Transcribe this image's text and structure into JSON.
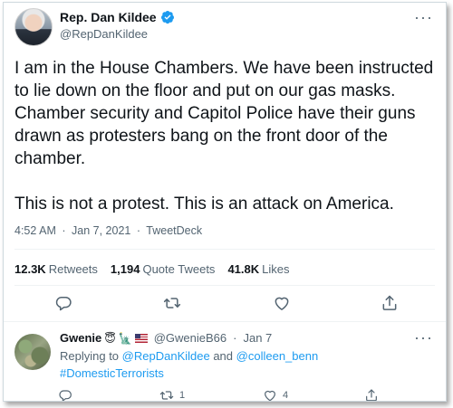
{
  "tweet": {
    "author_name": "Rep. Dan Kildee",
    "author_handle": "@RepDanKildee",
    "text": "I am in the House Chambers. We have been instructed\nto lie down on the floor and put on our gas masks.\nChamber security and Capitol Police have their guns\ndrawn as protesters bang on the front door of the\nchamber.\n\nThis is not a protest. This is an attack on America.",
    "time": "4:52 AM",
    "date": "Jan 7, 2021",
    "source": "TweetDeck",
    "separator": "·",
    "retweets_count": "12.3K",
    "retweets_label": "Retweets",
    "quotes_count": "1,194",
    "quotes_label": "Quote Tweets",
    "likes_count": "41.8K",
    "likes_label": "Likes",
    "more_glyph": "···"
  },
  "reply": {
    "author_name": "Gwenie",
    "author_handle": "@GwenieB66",
    "separator": "·",
    "date": "Jan 7",
    "replying_prefix": "Replying to",
    "replying_user1": "@RepDanKildee",
    "replying_and": "and",
    "replying_user2": "@colleen_benn",
    "hashtag": "#DomesticTerrorists",
    "retweet_count": "1",
    "like_count": "4",
    "more_glyph": "···"
  },
  "icons": {
    "verified": "verified-badge-icon",
    "reply": "reply-icon",
    "retweet": "retweet-icon",
    "like": "heart-icon",
    "share": "share-icon"
  },
  "colors": {
    "accent": "#1d9bf0",
    "secondary_text": "#536471",
    "primary_text": "#0f1419",
    "divider": "#eff3f4"
  }
}
